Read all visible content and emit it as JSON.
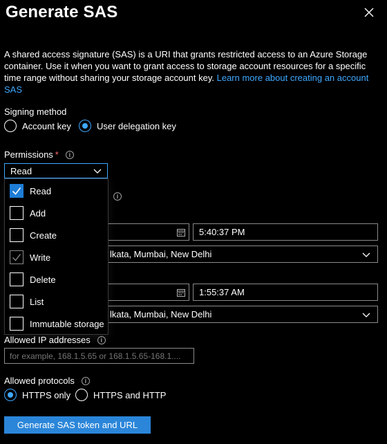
{
  "title": "Generate SAS",
  "description": "A shared access signature (SAS) is a URI that grants restricted access to an Azure Storage container. Use it when you want to grant access to storage account resources for a specific time range without sharing your storage account key.",
  "learn_more": "Learn more about creating an account SAS",
  "signing": {
    "label": "Signing method",
    "option_account": "Account key",
    "option_user": "User delegation key",
    "selected": "User delegation key"
  },
  "permissions": {
    "label": "Permissions",
    "required_mark": "*",
    "value": "Read",
    "options": [
      {
        "label": "Read",
        "checked": true
      },
      {
        "label": "Add",
        "checked": false
      },
      {
        "label": "Create",
        "checked": false
      },
      {
        "label": "Write",
        "checked": false
      },
      {
        "label": "Delete",
        "checked": false
      },
      {
        "label": "List",
        "checked": false
      },
      {
        "label": "Immutable storage",
        "checked": false
      }
    ]
  },
  "start": {
    "time": "5:40:37 PM",
    "timezone": "lkata, Mumbai, New Delhi"
  },
  "expiry": {
    "time": "1:55:37 AM",
    "timezone": "lkata, Mumbai, New Delhi"
  },
  "allowed_ip": {
    "label": "Allowed IP addresses",
    "placeholder": "for example, 168.1.5.65 or 168.1.5.65-168.1...."
  },
  "protocols": {
    "label": "Allowed protocols",
    "option_https": "HTTPS only",
    "option_both": "HTTPS and HTTP",
    "selected": "HTTPS only"
  },
  "generate_button": "Generate SAS token and URL",
  "colors": {
    "accent": "#3ea8ff",
    "button": "#2b86d9",
    "checkbox_checked": "#1e7dd6",
    "background": "#000000"
  }
}
